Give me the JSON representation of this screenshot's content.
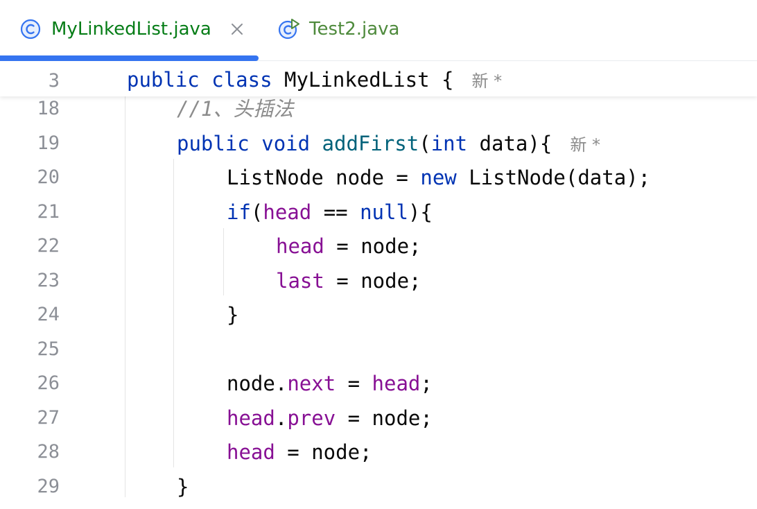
{
  "tabs": [
    {
      "label": "MyLinkedList.java",
      "icon": "class-icon",
      "active": true,
      "close": "×"
    },
    {
      "label": "Test2.java",
      "icon": "class-run-icon",
      "active": false
    }
  ],
  "colors": {
    "accent": "#3574f0",
    "keyword": "#0033b3",
    "method": "#00627a",
    "field": "#871094",
    "comment": "#8c8c8c",
    "line_number": "#8c8f96",
    "active_tab_text": "#067d17"
  },
  "sticky_line": {
    "number": "3",
    "kw1": "public",
    "kw2": "class",
    "name": "MyLinkedList {",
    "hint": "新 *"
  },
  "lines": [
    {
      "number": "18",
      "comment": "//1、头插法"
    },
    {
      "number": "19",
      "kw1": "public",
      "kw2": "void",
      "method": "addFirst",
      "p1": "(",
      "kw3": "int",
      "p2": " data){",
      "hint": "新 *"
    },
    {
      "number": "20",
      "t1": "ListNode node = ",
      "kw": "new",
      "t2": " ListNode(data);"
    },
    {
      "number": "21",
      "kw": "if",
      "t1": "(",
      "fld": "head",
      "t2": " == ",
      "kw2": "null",
      "t3": "){"
    },
    {
      "number": "22",
      "fld": "head",
      "t1": " = node;"
    },
    {
      "number": "23",
      "fld": "last",
      "t1": " = node;"
    },
    {
      "number": "24",
      "t1": "}"
    },
    {
      "number": "25"
    },
    {
      "number": "26",
      "t1": "node.",
      "fld": "next",
      "t2": " = ",
      "fld2": "head",
      "t3": ";"
    },
    {
      "number": "27",
      "fld": "head",
      "t1": ".",
      "fld2": "prev",
      "t2": " = node;"
    },
    {
      "number": "28",
      "fld": "head",
      "t1": " = node;"
    },
    {
      "number": "29",
      "t1": "}"
    }
  ]
}
